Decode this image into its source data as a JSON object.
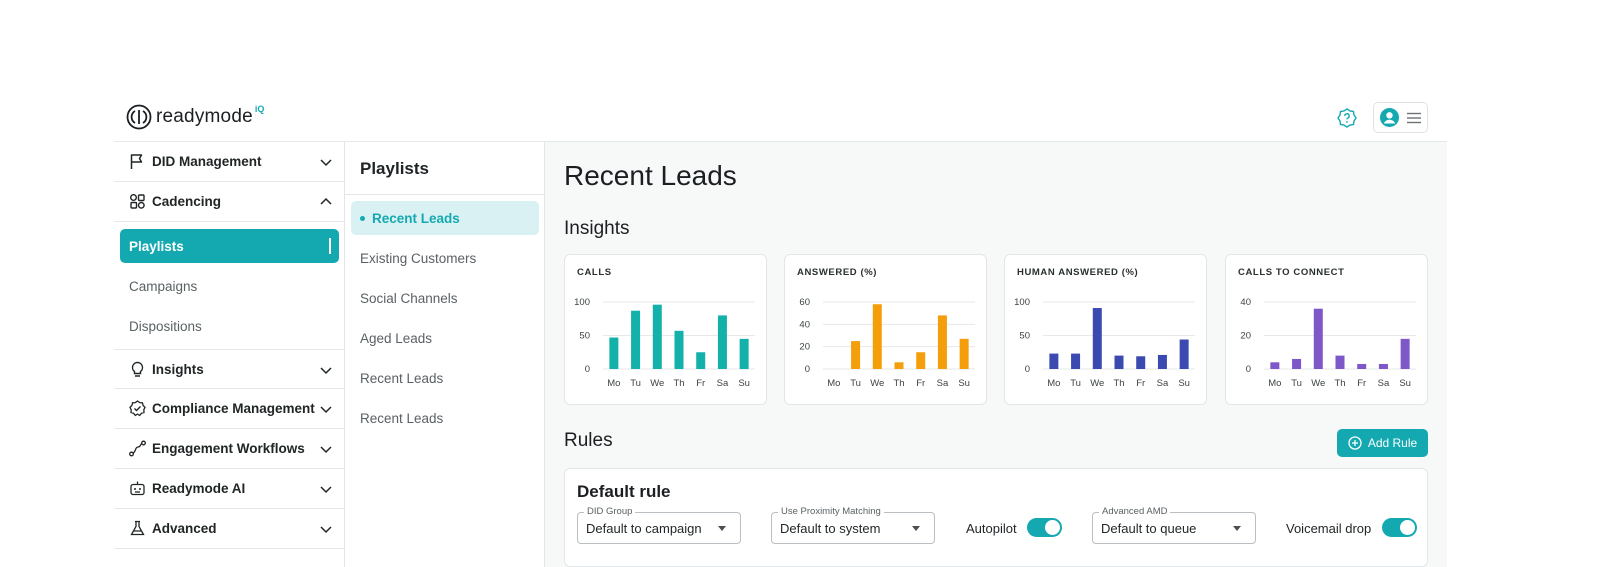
{
  "brand": {
    "name": "readymode",
    "badge": "iQ",
    "accent": "#14a9b1"
  },
  "sidebar": {
    "items": [
      {
        "label": "DID Management",
        "icon": "flag-icon",
        "expanded": false
      },
      {
        "label": "Cadencing",
        "icon": "shapes-icon",
        "expanded": true,
        "children": [
          {
            "label": "Playlists",
            "active": true
          },
          {
            "label": "Campaigns"
          },
          {
            "label": "Dispositions"
          }
        ]
      },
      {
        "label": "Insights",
        "icon": "lightbulb-icon",
        "expanded": false
      },
      {
        "label": "Compliance Management",
        "icon": "badge-check-icon",
        "expanded": false
      },
      {
        "label": "Engagement Workflows",
        "icon": "workflow-icon",
        "expanded": false
      },
      {
        "label": "Readymode AI",
        "icon": "robot-icon",
        "expanded": false
      },
      {
        "label": "Advanced",
        "icon": "flask-icon",
        "expanded": false
      }
    ]
  },
  "playlists": {
    "title": "Playlists",
    "items": [
      {
        "label": "Recent Leads",
        "active": true
      },
      {
        "label": "Existing Customers"
      },
      {
        "label": "Social Channels"
      },
      {
        "label": "Aged Leads"
      },
      {
        "label": "Recent Leads"
      },
      {
        "label": "Recent Leads"
      }
    ]
  },
  "main": {
    "title": "Recent Leads",
    "insights_title": "Insights",
    "rules_title": "Rules",
    "add_rule_label": "Add Rule",
    "rule": {
      "title": "Default rule",
      "did_group": {
        "legend": "DID Group",
        "value": "Default to campaign"
      },
      "proximity": {
        "legend": "Use Proximity Matching",
        "value": "Default to system"
      },
      "autopilot": {
        "label": "Autopilot",
        "on": true
      },
      "amd": {
        "legend": "Advanced AMD",
        "value": "Default to queue"
      },
      "voicemail": {
        "label": "Voicemail drop",
        "on": true
      }
    }
  },
  "chart_data": [
    {
      "type": "bar",
      "title": "CALLS",
      "color": "#14b1ab",
      "categories": [
        "Mo",
        "Tu",
        "We",
        "Th",
        "Fr",
        "Sa",
        "Su"
      ],
      "values": [
        47,
        87,
        96,
        57,
        25,
        80,
        45
      ],
      "ylim": [
        0,
        100
      ],
      "yticks": [
        0,
        50,
        100
      ]
    },
    {
      "type": "bar",
      "title": "ANSWERED (%)",
      "color": "#f59e0b",
      "categories": [
        "Mo",
        "Tu",
        "We",
        "Th",
        "Fr",
        "Sa",
        "Su"
      ],
      "values": [
        0,
        25,
        58,
        6,
        15,
        48,
        27
      ],
      "ylim": [
        0,
        60
      ],
      "yticks": [
        0,
        20,
        40,
        60
      ]
    },
    {
      "type": "bar",
      "title": "HUMAN ANSWERED (%)",
      "color": "#3b4ab0",
      "categories": [
        "Mo",
        "Tu",
        "We",
        "Th",
        "Fr",
        "Sa",
        "Su"
      ],
      "values": [
        23,
        23,
        91,
        20,
        19,
        21,
        44
      ],
      "ylim": [
        0,
        100
      ],
      "yticks": [
        0,
        50,
        100
      ]
    },
    {
      "type": "bar",
      "title": "CALLS TO CONNECT",
      "color": "#7e57c8",
      "categories": [
        "Mo",
        "Tu",
        "We",
        "Th",
        "Fr",
        "Sa",
        "Su"
      ],
      "values": [
        4,
        6,
        36,
        8,
        3,
        3,
        18
      ],
      "ylim": [
        0,
        40
      ],
      "yticks": [
        0,
        20,
        40
      ]
    }
  ]
}
